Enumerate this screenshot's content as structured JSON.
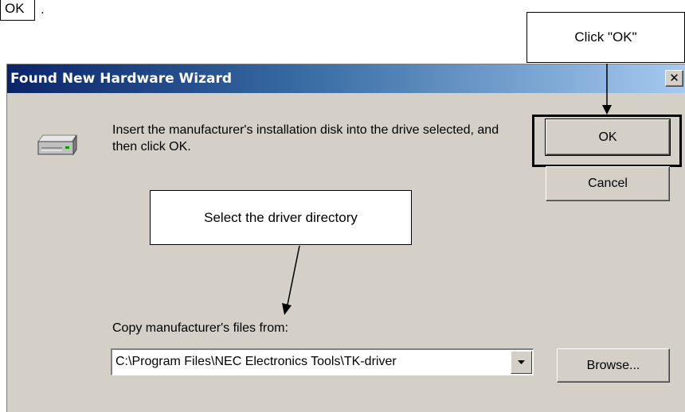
{
  "document": {
    "ok_fragment": "OK",
    "trailing_period": "."
  },
  "callouts": {
    "click_ok": "Click \"OK\"",
    "select_dir": "Select the driver directory"
  },
  "dialog": {
    "title": "Found New Hardware Wizard",
    "close_glyph": "×",
    "drive_icon": "disk-drive-icon",
    "instruction": "Insert the manufacturer's installation disk into the drive selected, and then click OK.",
    "ok_label": "OK",
    "cancel_label": "Cancel",
    "copy_label": "Copy manufacturer's files from:",
    "path_value": "C:\\Program Files\\NEC Electronics Tools\\TK-driver",
    "browse_label": "Browse..."
  },
  "colors": {
    "titlebar_start": "#0a246a",
    "titlebar_end": "#a6caf0",
    "dialog_face": "#d4d0c8"
  }
}
